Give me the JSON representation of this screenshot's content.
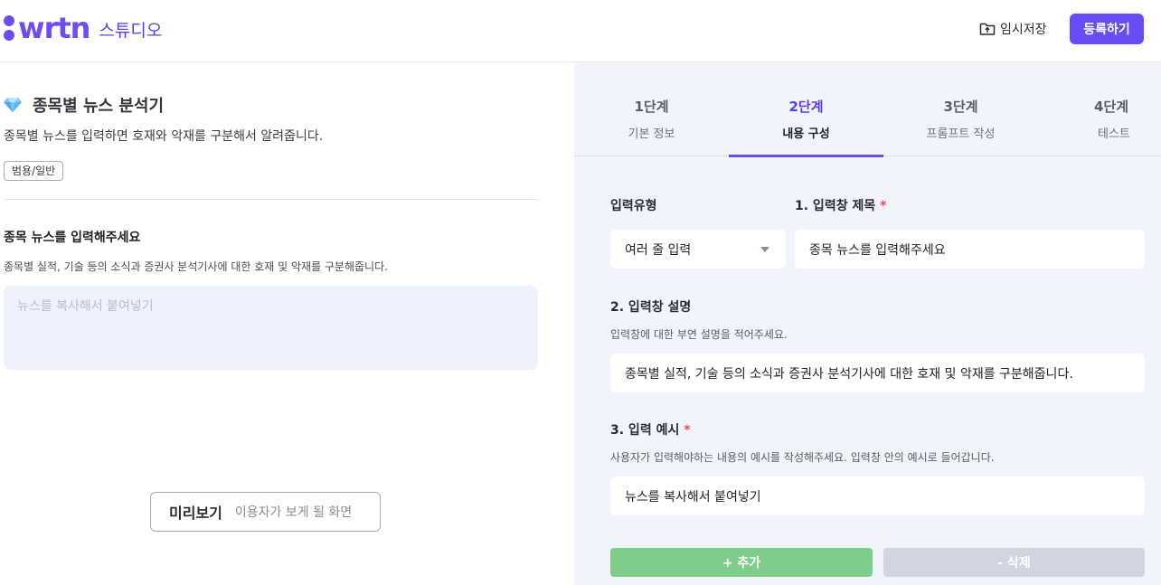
{
  "header": {
    "logo_text": "wrtn",
    "studio_label": "스튜디오",
    "save_label": "임시저장",
    "register_label": "등록하기"
  },
  "bot": {
    "title": "종목별 뉴스 분석기",
    "description": "종목별 뉴스를 입력하면 호재와 악재를 구분해서 알려줍니다.",
    "category_tag": "범용/일반"
  },
  "preview_form": {
    "field_title": "종목 뉴스를 입력해주세요",
    "field_description": "종목별 실적, 기술 등의 소식과 증권사 분석기사에 대한 호재 및 악재를 구분해줍니다.",
    "field_placeholder": "뉴스를 복사해서 붙여넣기"
  },
  "preview_button": {
    "label": "미리보기",
    "sub_label": "이용자가 보게 될 화면"
  },
  "steps": [
    {
      "number": "1단계",
      "label": "기본 정보",
      "active": false
    },
    {
      "number": "2단계",
      "label": "내용 구성",
      "active": true
    },
    {
      "number": "3단계",
      "label": "프롬프트 작성",
      "active": false
    },
    {
      "number": "4단계",
      "label": "테스트",
      "active": false
    }
  ],
  "editor": {
    "input_type_label": "입력유형",
    "input_type_value": "여러 줄 입력",
    "title_label": "1. 입력창 제목",
    "title_value": "종목 뉴스를 입력해주세요",
    "desc_label": "2. 입력창 설명",
    "desc_hint": "입력창에 대한 부연 설명을 적어주세요.",
    "desc_value": "종목별 실적, 기술 등의 소식과 증권사 분석기사에 대한 호재 및 악재를 구분해줍니다.",
    "example_label": "3. 입력 예시",
    "example_hint": "사용자가 입력해야하는 내용의 예시를 작성해주세요. 입력창 안의 예시로 들어갑니다.",
    "example_value": "뉴스를 복사해서 붙여넣기",
    "required_mark": "*",
    "add_label": "+ 추가",
    "delete_label": "- 삭제"
  },
  "colors": {
    "brand": "#6a4cf4",
    "add_button": "#7fcd8a",
    "delete_button": "#d1d4e1",
    "required": "#f0494f"
  }
}
